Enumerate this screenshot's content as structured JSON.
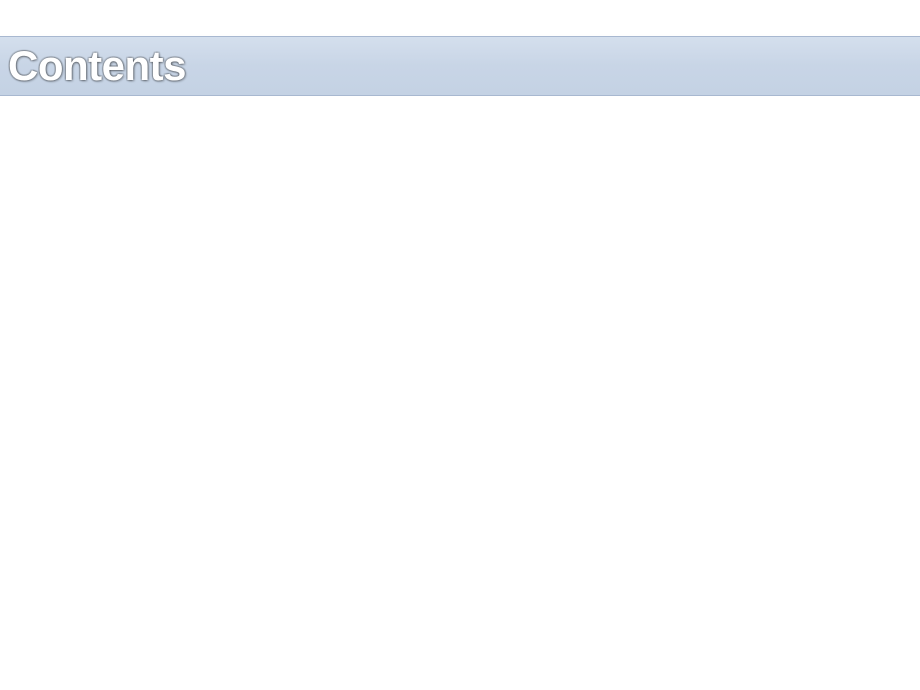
{
  "header": {
    "title": "Contents"
  }
}
